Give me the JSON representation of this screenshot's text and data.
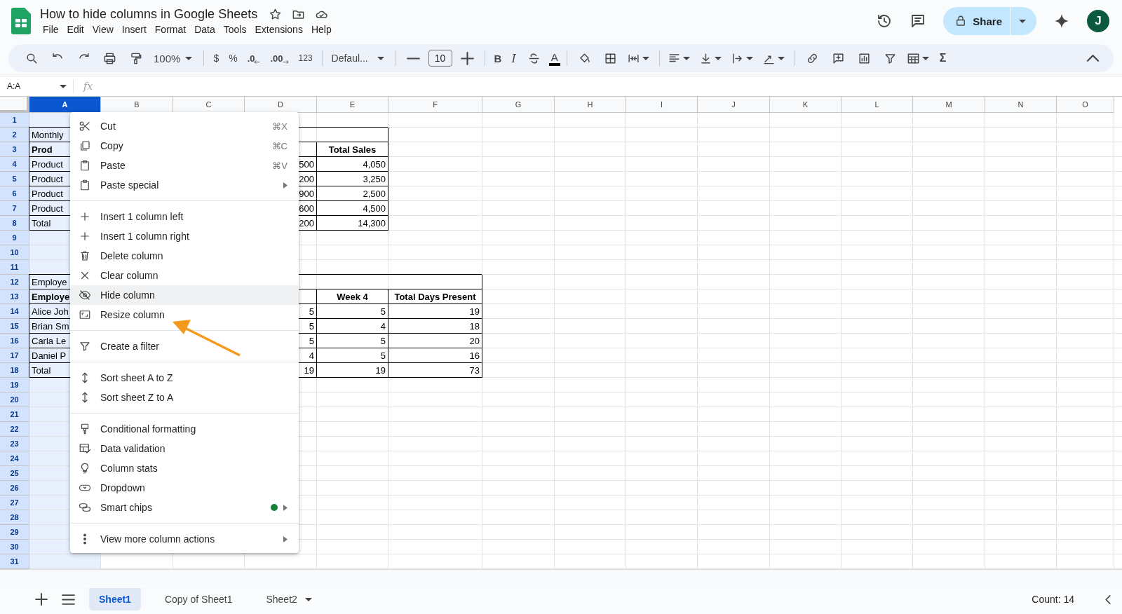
{
  "document": {
    "title": "How to hide columns in Google Sheets"
  },
  "menu_bar": [
    "File",
    "Edit",
    "View",
    "Insert",
    "Format",
    "Data",
    "Tools",
    "Extensions",
    "Help"
  ],
  "share": {
    "label": "Share"
  },
  "avatar": {
    "initial": "J"
  },
  "toolbar": {
    "zoom": "100%",
    "currency": "$",
    "percent": "%",
    "decrease_decimal": ".0",
    "increase_decimal": ".00",
    "number_format": "123",
    "font": "Defaul...",
    "font_size": "10",
    "bold": "B",
    "italic": "I",
    "text_color": "A",
    "functions": "Σ"
  },
  "formula_bar": {
    "name_box": "A:A",
    "formula_label": "fx"
  },
  "columns": [
    {
      "label": "A",
      "selected": true
    },
    {
      "label": "B",
      "selected": false
    },
    {
      "label": "C",
      "selected": false
    },
    {
      "label": "D",
      "selected": false
    },
    {
      "label": "E",
      "selected": false
    },
    {
      "label": "F",
      "selected": false
    },
    {
      "label": "G",
      "selected": false
    },
    {
      "label": "H",
      "selected": false
    },
    {
      "label": "I",
      "selected": false
    },
    {
      "label": "J",
      "selected": false
    },
    {
      "label": "K",
      "selected": false
    },
    {
      "label": "L",
      "selected": false
    },
    {
      "label": "M",
      "selected": false
    },
    {
      "label": "N",
      "selected": false
    },
    {
      "label": "O",
      "selected": false
    }
  ],
  "row_headers": [
    "1",
    "2",
    "3",
    "4",
    "5",
    "6",
    "7",
    "8",
    "9",
    "10",
    "11",
    "12",
    "13",
    "14",
    "15",
    "16",
    "17",
    "18",
    "19",
    "20",
    "21",
    "22",
    "23",
    "24",
    "25",
    "26",
    "27",
    "28",
    "29",
    "30",
    "31"
  ],
  "sales_table": {
    "title": "Monthly",
    "headers": [
      "Prod",
      "Total Sales"
    ],
    "rows": [
      [
        "Product",
        "500",
        "4,050"
      ],
      [
        "Product",
        "200",
        "3,250"
      ],
      [
        "Product",
        "900",
        "2,500"
      ],
      [
        "Product",
        "600",
        "4,500"
      ],
      [
        "Total",
        "200",
        "14,300"
      ]
    ]
  },
  "attendance_table": {
    "title": "Employe",
    "headers": [
      "Employe",
      "Week 4",
      "Total Days Present"
    ],
    "rows": [
      [
        "Alice Joh",
        "5",
        "5",
        "19"
      ],
      [
        "Brian Sm",
        "5",
        "4",
        "18"
      ],
      [
        "Carla Le",
        "5",
        "5",
        "20"
      ],
      [
        "Daniel P",
        "4",
        "5",
        "16"
      ],
      [
        "Total",
        "19",
        "19",
        "73"
      ]
    ]
  },
  "context_menu": {
    "items": [
      {
        "kind": "item",
        "label": "Cut",
        "shortcut": "⌘X",
        "selected": false
      },
      {
        "kind": "item",
        "label": "Copy",
        "shortcut": "⌘C",
        "selected": false
      },
      {
        "kind": "item",
        "label": "Paste",
        "shortcut": "⌘V",
        "selected": false
      },
      {
        "kind": "item",
        "label": "Paste special",
        "submenu": true,
        "selected": false
      },
      {
        "kind": "separator"
      },
      {
        "kind": "item",
        "label": "Insert 1 column left",
        "selected": false
      },
      {
        "kind": "item",
        "label": "Insert 1 column right",
        "selected": false
      },
      {
        "kind": "item",
        "label": "Delete column",
        "selected": false
      },
      {
        "kind": "item",
        "label": "Clear column",
        "selected": false
      },
      {
        "kind": "item",
        "label": "Hide column",
        "selected": true
      },
      {
        "kind": "item",
        "label": "Resize column",
        "selected": false
      },
      {
        "kind": "separator"
      },
      {
        "kind": "item",
        "label": "Create a filter",
        "selected": false
      },
      {
        "kind": "separator"
      },
      {
        "kind": "item",
        "label": "Sort sheet A to Z",
        "selected": false
      },
      {
        "kind": "item",
        "label": "Sort sheet Z to A",
        "selected": false
      },
      {
        "kind": "separator"
      },
      {
        "kind": "item",
        "label": "Conditional formatting",
        "selected": false
      },
      {
        "kind": "item",
        "label": "Data validation",
        "selected": false
      },
      {
        "kind": "item",
        "label": "Column stats",
        "selected": false
      },
      {
        "kind": "item",
        "label": "Dropdown",
        "selected": false
      },
      {
        "kind": "item",
        "label": "Smart chips",
        "submenu": true,
        "color": "#188038",
        "selected": false
      },
      {
        "kind": "separator"
      },
      {
        "kind": "item",
        "label": "View more column actions",
        "submenu": true,
        "selected": false
      }
    ]
  },
  "sheet_tabs": [
    {
      "label": "Sheet1",
      "selected": true,
      "menu": false
    },
    {
      "label": "Copy of Sheet1",
      "selected": false,
      "menu": false
    },
    {
      "label": "Sheet2",
      "selected": false,
      "menu": true
    }
  ],
  "status": {
    "summary": "Count: 14"
  }
}
